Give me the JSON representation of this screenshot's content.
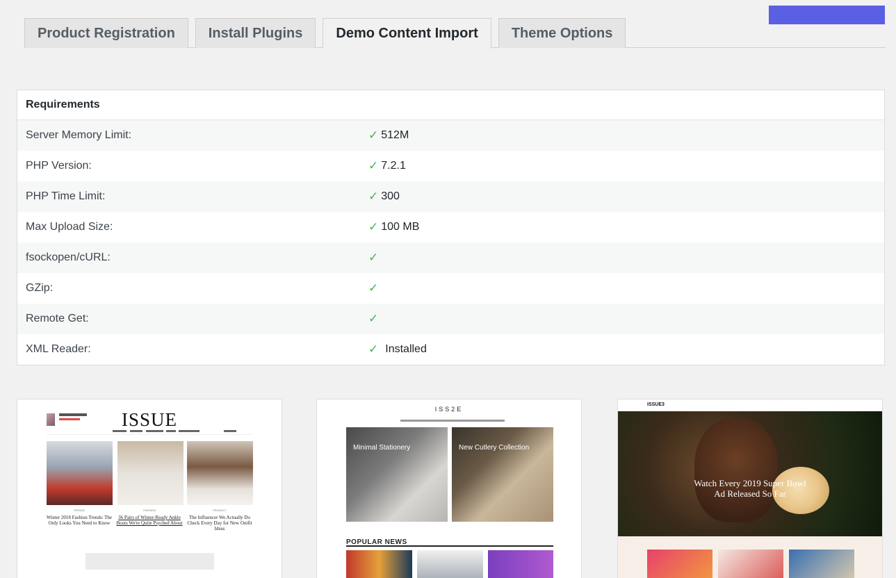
{
  "tabs": [
    {
      "label": "Product Registration",
      "active": false
    },
    {
      "label": "Install Plugins",
      "active": false
    },
    {
      "label": "Demo Content Import",
      "active": true
    },
    {
      "label": "Theme Options",
      "active": false
    }
  ],
  "requirements": {
    "heading": "Requirements",
    "rows": [
      {
        "label": "Server Memory Limit:",
        "value": "512M",
        "ok": true
      },
      {
        "label": "PHP Version:",
        "value": "7.2.1",
        "ok": true
      },
      {
        "label": "PHP Time Limit:",
        "value": "300",
        "ok": true
      },
      {
        "label": "Max Upload Size:",
        "value": "100 MB",
        "ok": true
      },
      {
        "label": "fsockopen/cURL:",
        "value": "",
        "ok": true
      },
      {
        "label": "GZip:",
        "value": "",
        "ok": true
      },
      {
        "label": "Remote Get:",
        "value": "",
        "ok": true
      },
      {
        "label": "XML Reader:",
        "value": "Installed",
        "ok": true
      }
    ]
  },
  "demos": {
    "demo1": {
      "logo": "ISSUE",
      "captions": [
        "Winter 2018 Fashion Trends: The Only Looks You Need to Know",
        "36 Pairs of Winter-Ready Ankle Boots We're Quite Psyched About",
        "The Influencer We Actually Do Check Every Day for New Outfit Ideas"
      ]
    },
    "demo2": {
      "logo": "ISS2E",
      "card1_title": "Minimal Stationery",
      "card2_title": "New Cutlery Collection",
      "section_title": "POPULAR NEWS"
    },
    "demo3": {
      "logo": "ISSUE3",
      "hero_title_line1": "Watch Every 2019 Super Bowl",
      "hero_title_line2": "Ad Released So Far"
    }
  },
  "colors": {
    "accent": "#5b5fe3",
    "check": "#46b450"
  }
}
